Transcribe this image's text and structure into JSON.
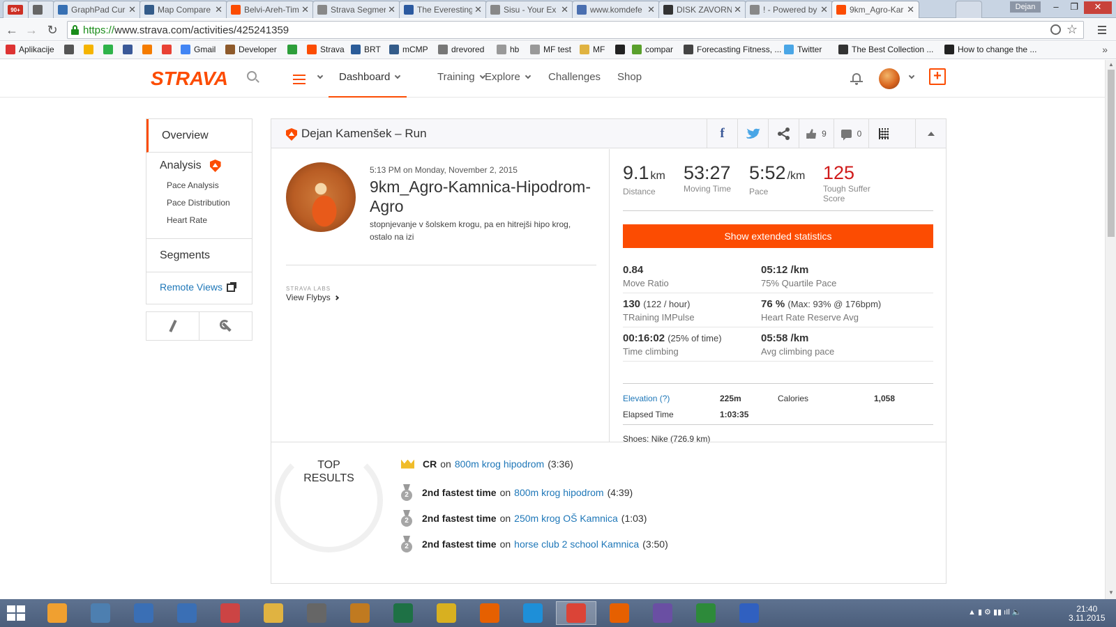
{
  "browser": {
    "tabs": [
      {
        "title": "",
        "icon": "gmail-icon",
        "badge": "90+",
        "color": "#cd2f24"
      },
      {
        "title": "",
        "icon": "puzzle-icon",
        "color": "#666666"
      },
      {
        "title": "GraphPad Cur",
        "icon": "graphpad-icon",
        "color": "#3770b3"
      },
      {
        "title": "Map Compare",
        "icon": "bicycle-icon",
        "color": "#345c8a"
      },
      {
        "title": "Belvi-Areh-Tim",
        "icon": "strava-icon",
        "color": "#fc4c02"
      },
      {
        "title": "Strava Segmer",
        "icon": "page-icon",
        "color": "#888888"
      },
      {
        "title": "The Everesting",
        "icon": "everesting-icon",
        "color": "#2c5aa0"
      },
      {
        "title": "Sisu - Your Ex",
        "icon": "page-icon",
        "color": "#888888"
      },
      {
        "title": "www.komdefe",
        "icon": "doc-icon",
        "color": "#4a6fb0"
      },
      {
        "title": "DISK ZAVORN",
        "icon": "gear-icon",
        "color": "#333333"
      },
      {
        "title": "! - Powered by",
        "icon": "page-icon",
        "color": "#888888"
      },
      {
        "title": "9km_Agro-Kar",
        "icon": "strava-icon",
        "color": "#fc4c02"
      }
    ],
    "user_badge": "Dejan",
    "url_scheme": "https://",
    "url_rest": "www.strava.com/activities/425241359",
    "bookmarks": [
      {
        "label": "Aplikacije",
        "icon": "apps-grid-icon",
        "color": "#d33"
      },
      {
        "label": "",
        "icon": "puzzle-icon",
        "color": "#555"
      },
      {
        "label": "",
        "icon": "keep-icon",
        "color": "#f5b400"
      },
      {
        "label": "",
        "icon": "whatsapp-icon",
        "color": "#2fb34a"
      },
      {
        "label": "",
        "icon": "facebook-icon",
        "color": "#3b5998"
      },
      {
        "label": "",
        "icon": "trend-icon",
        "color": "#f57c00"
      },
      {
        "label": "",
        "icon": "pinwheel-icon",
        "color": "#e94235"
      },
      {
        "label": "Gmail",
        "icon": "google-icon",
        "color": "#4285f4"
      },
      {
        "label": "Developer",
        "icon": "person-icon",
        "color": "#8e5a2b"
      },
      {
        "label": "",
        "icon": "g-green-icon",
        "color": "#2d9e3a"
      },
      {
        "label": "Strava",
        "icon": "strava-icon",
        "color": "#fc4c02"
      },
      {
        "label": "BRT",
        "icon": "brt-icon",
        "color": "#2b5c99"
      },
      {
        "label": "mCMP",
        "icon": "bicycle-icon",
        "color": "#345c8a"
      },
      {
        "label": "drevored",
        "icon": "bike-gray-icon",
        "color": "#777"
      },
      {
        "label": "hb",
        "icon": "page-icon",
        "color": "#999"
      },
      {
        "label": "MF test",
        "icon": "page-icon",
        "color": "#999"
      },
      {
        "label": "MF",
        "icon": "folder-icon",
        "color": "#e0b341"
      },
      {
        "label": "",
        "icon": "github-icon",
        "color": "#222"
      },
      {
        "label": "compar",
        "icon": "compare-icon",
        "color": "#5aa02c"
      },
      {
        "label": "Forecasting Fitness, ...",
        "icon": "forecast-icon",
        "color": "#444"
      },
      {
        "label": "Twitter",
        "icon": "twitter-icon",
        "color": "#4aa6e6"
      },
      {
        "label": "The Best Collection ...",
        "icon": "collection-icon",
        "color": "#333"
      },
      {
        "label": "How to change the ...",
        "icon": "puzzle-dark-icon",
        "color": "#222"
      }
    ]
  },
  "header": {
    "logo": "STRAVA",
    "nav": [
      "Dashboard",
      "Training",
      "Explore",
      "Challenges",
      "Shop"
    ]
  },
  "sidebar": {
    "overview": "Overview",
    "analysis": "Analysis",
    "analysis_items": [
      "Pace Analysis",
      "Pace Distribution",
      "Heart Rate"
    ],
    "segments": "Segments",
    "remote_views": "Remote Views"
  },
  "activity": {
    "title": "Dejan Kamenšek – Run",
    "kudos": "9",
    "comments": "0",
    "datetime": "5:13 PM on Monday, November 2, 2015",
    "name": "9km_Agro-Kamnica-Hipodrom-Agro",
    "description": "stopnjevanje v šolskem krogu, pa en hitrejši hipo krog, ostalo na izi",
    "labs_label": "STRAVA LABS",
    "labs_link": "View Flybys"
  },
  "stats": {
    "distance": {
      "value": "9.1",
      "unit": "km",
      "label": "Distance"
    },
    "moving_time": {
      "value": "53:27",
      "label": "Moving Time"
    },
    "pace": {
      "value": "5:52",
      "unit": "/km",
      "label": "Pace"
    },
    "suffer": {
      "value": "125",
      "label": "Tough Suffer Score"
    },
    "extended_button": "Show extended statistics",
    "move_ratio": {
      "value": "0.84",
      "label": "Move Ratio"
    },
    "quartile_pace": {
      "value": "05:12 /km",
      "label": "75% Quartile Pace"
    },
    "training_impulse": {
      "value": "130",
      "extra": "(122 / hour)",
      "label": "TRaining IMPulse"
    },
    "hrr_avg": {
      "value": "76 %",
      "extra": "(Max: 93% @ 176bpm)",
      "label": "Heart Rate Reserve Avg"
    },
    "time_climbing": {
      "value": "00:16:02",
      "extra": "(25% of time)",
      "label": "Time climbing"
    },
    "climbing_pace": {
      "value": "05:58 /km",
      "label": "Avg climbing pace"
    },
    "elevation_label": "Elevation (?)",
    "elevation_value": "225m",
    "calories_label": "Calories",
    "calories_value": "1,058",
    "elapsed_label": "Elapsed Time",
    "elapsed_value": "1:03:35",
    "shoes": "Shoes: Nike (726.9 km)"
  },
  "top_results": {
    "heading": "TOP RESULTS",
    "rows": [
      {
        "achievement": "CR",
        "on": "on",
        "segment": "800m krog hipodrom",
        "time": "(3:36)",
        "icon": "crown-icon"
      },
      {
        "achievement": "2nd fastest time",
        "on": "on",
        "segment": "800m krog hipodrom",
        "time": "(4:39)",
        "icon": "silver-medal-icon",
        "rank": "2"
      },
      {
        "achievement": "2nd fastest time",
        "on": "on",
        "segment": "250m krog OŠ Kamnica",
        "time": "(1:03)",
        "icon": "silver-medal-icon",
        "rank": "2"
      },
      {
        "achievement": "2nd fastest time",
        "on": "on",
        "segment": "horse club 2 school Kamnica",
        "time": "(3:50)",
        "icon": "silver-medal-icon",
        "rank": "2"
      }
    ]
  },
  "taskbar": {
    "apps": [
      {
        "icon": "outlook-icon",
        "color": "#f0a030"
      },
      {
        "icon": "window-app-icon",
        "color": "#4d7fb0"
      },
      {
        "icon": "computer-app-icon",
        "color": "#3a6fb5"
      },
      {
        "icon": "network-app-icon",
        "color": "#3a6fb5"
      },
      {
        "icon": "hardware-app-icon",
        "color": "#c44"
      },
      {
        "icon": "file-explorer-icon",
        "color": "#e0b341"
      },
      {
        "icon": "calculator-icon",
        "color": "#666"
      },
      {
        "icon": "paw-app-icon",
        "color": "#c07a20"
      },
      {
        "icon": "excel-icon",
        "color": "#1e7145"
      },
      {
        "icon": "ultraedit-icon",
        "color": "#d8b020"
      },
      {
        "icon": "firefox-icon",
        "color": "#e66000"
      },
      {
        "icon": "ie-icon",
        "color": "#1e8fd8"
      },
      {
        "icon": "chrome-icon",
        "color": "#db4437"
      },
      {
        "icon": "firefox-icon",
        "color": "#e66000"
      },
      {
        "icon": "cat-app-icon",
        "color": "#6a4fa3"
      },
      {
        "icon": "terminal-app-icon",
        "color": "#2d8a3a"
      },
      {
        "icon": "opera-app-icon",
        "color": "#3060c0"
      }
    ],
    "time": "21:40",
    "date": "3.11.2015"
  }
}
